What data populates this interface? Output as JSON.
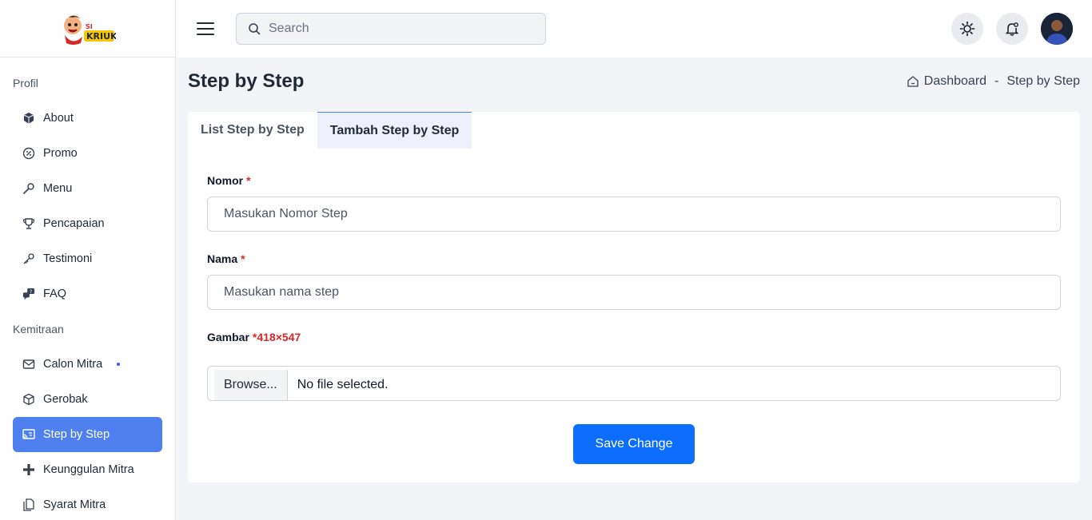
{
  "brand": {
    "logo_text": "SI KRIUK"
  },
  "sidebar": {
    "sections": [
      {
        "title": "Profil",
        "items": [
          {
            "label": "About",
            "icon": "box-icon"
          },
          {
            "label": "Promo",
            "icon": "discount-icon"
          },
          {
            "label": "Menu",
            "icon": "spoon-icon"
          },
          {
            "label": "Pencapaian",
            "icon": "trophy-icon"
          },
          {
            "label": "Testimoni",
            "icon": "key-icon"
          },
          {
            "label": "FAQ",
            "icon": "chat-question-icon"
          }
        ]
      },
      {
        "title": "Kemitraan",
        "items": [
          {
            "label": "Calon Mitra",
            "icon": "mail-icon",
            "dot": true
          },
          {
            "label": "Gerobak",
            "icon": "package-icon"
          },
          {
            "label": "Step by Step",
            "icon": "cast-icon",
            "active": true
          },
          {
            "label": "Keunggulan Mitra",
            "icon": "plus-icon"
          },
          {
            "label": "Syarat Mitra",
            "icon": "documents-icon"
          }
        ]
      }
    ]
  },
  "topbar": {
    "search_placeholder": "Search"
  },
  "page": {
    "title": "Step by Step",
    "breadcrumb": {
      "home": "Dashboard",
      "separator": "-",
      "current": "Step by Step"
    }
  },
  "tabs": [
    {
      "label": "List Step by Step",
      "active": false
    },
    {
      "label": "Tambah Step by Step",
      "active": true
    }
  ],
  "form": {
    "nomor": {
      "label": "Nomor",
      "required": "*",
      "placeholder": "Masukan Nomor Step",
      "value": ""
    },
    "nama": {
      "label": "Nama",
      "required": "*",
      "placeholder": "Masukan nama step",
      "value": ""
    },
    "gambar": {
      "label": "Gambar",
      "required": "*418×547",
      "browse_label": "Browse...",
      "file_status": "No file selected."
    },
    "save_label": "Save Change"
  },
  "colors": {
    "accent": "#4f80f0",
    "primary_button": "#0d6efd",
    "required": "#dc2626"
  }
}
